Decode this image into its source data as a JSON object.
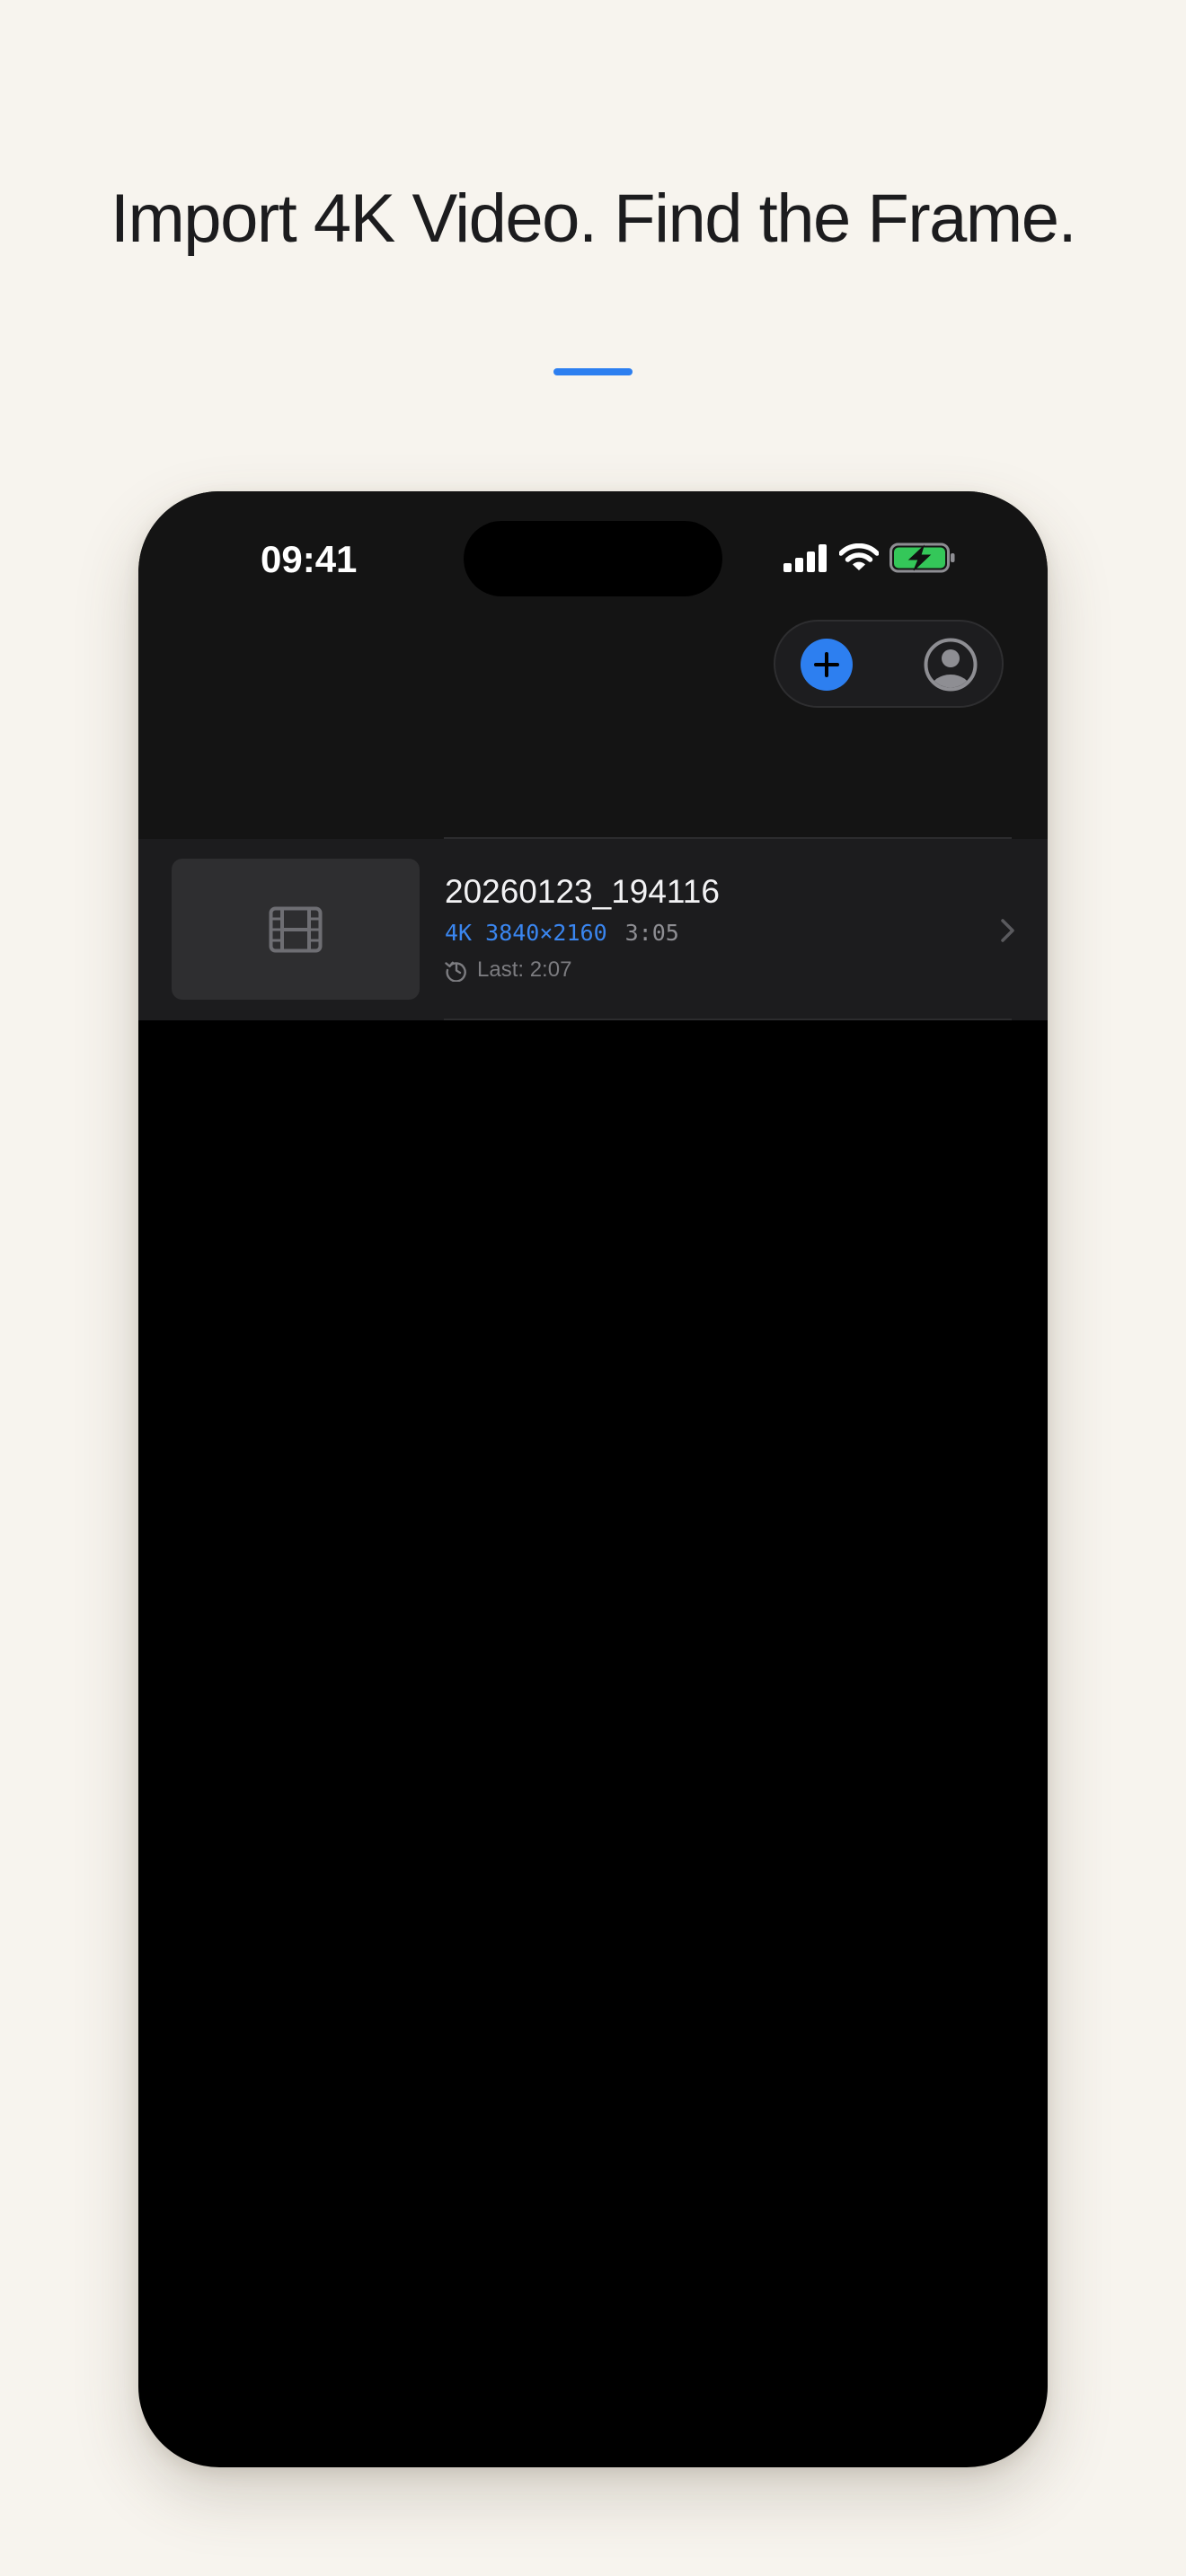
{
  "headline": "Import 4K Video. Find the Frame.",
  "colors": {
    "accent": "#2d7ff0",
    "background": "#f7f4ee",
    "battery": "#34c759"
  },
  "status_bar": {
    "time": "09:41",
    "icons": [
      "cellular-signal-icon",
      "wifi-icon",
      "battery-charging-icon"
    ]
  },
  "toolbar": {
    "buttons": [
      "plus-icon",
      "person-circle-icon"
    ]
  },
  "videos": [
    {
      "title": "20260123_194116",
      "resolution": "4K 3840×2160",
      "duration": "3:05",
      "last_position": "Last: 2:07",
      "thumbnail_icon": "film-icon"
    }
  ]
}
